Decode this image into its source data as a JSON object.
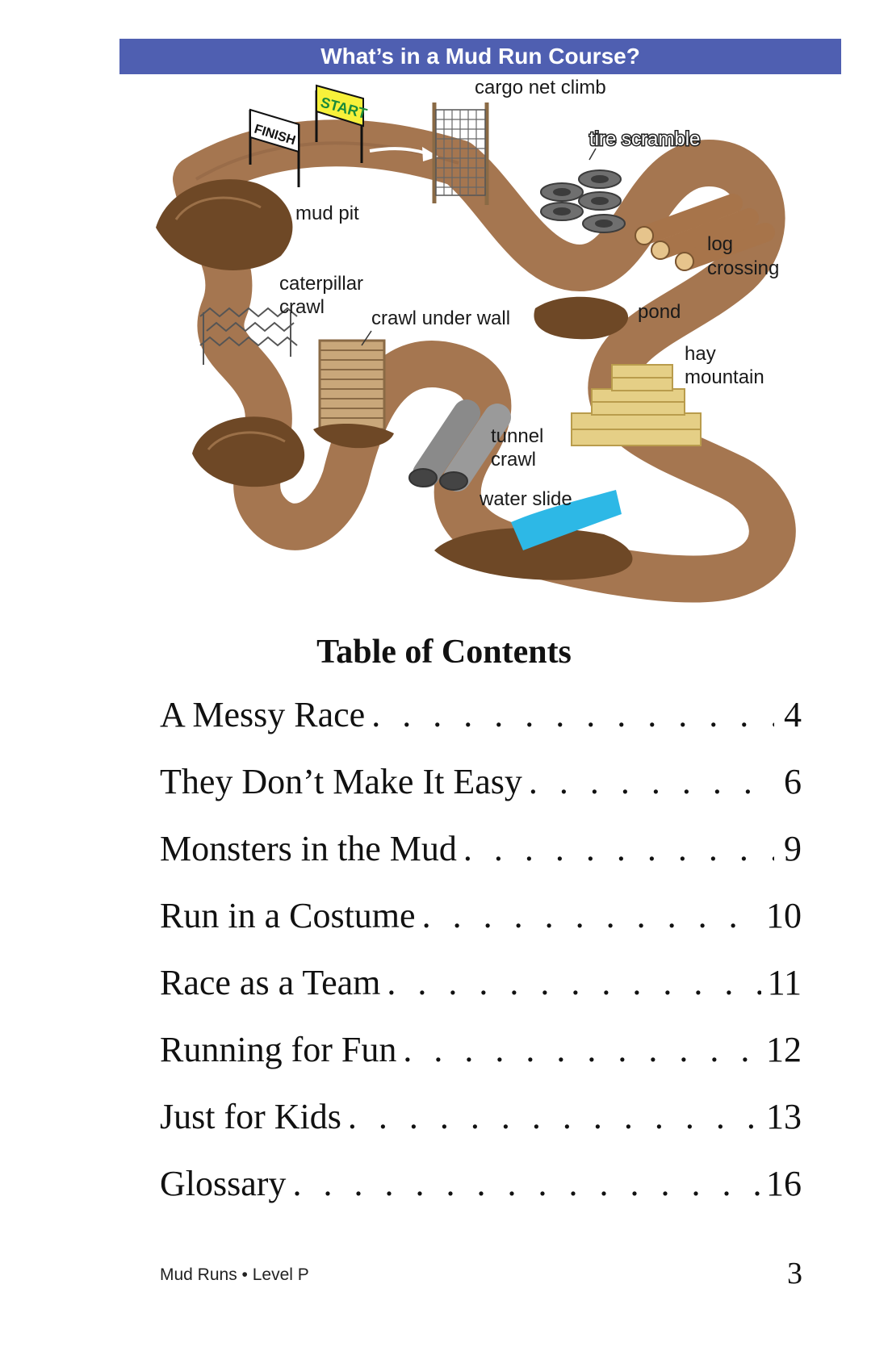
{
  "banner": {
    "title": "What’s in a Mud Run Course?"
  },
  "course": {
    "flags": {
      "finish": "FINISH",
      "start": "START"
    },
    "labels": {
      "cargo_net": "cargo net climb",
      "tire_scramble": "tire scramble",
      "mud_pit": "mud pit",
      "log_crossing_1": "log",
      "log_crossing_2": "crossing",
      "caterpillar_1": "caterpillar",
      "caterpillar_2": "crawl",
      "crawl_wall": "crawl under wall",
      "pond": "pond",
      "hay_1": "hay",
      "hay_2": "mountain",
      "tunnel_1": "tunnel",
      "tunnel_2": "crawl",
      "water_slide": "water slide"
    },
    "colors": {
      "track": "#a57650",
      "mud": "#6e4826",
      "water": "#2db8e6",
      "hay": "#e5cf86",
      "tire": "#6f6f6f"
    }
  },
  "toc": {
    "title": "Table of Contents",
    "entries": [
      {
        "title": "A Messy Race",
        "page": "4"
      },
      {
        "title": "They Don’t Make It Easy",
        "page": "6"
      },
      {
        "title": "Monsters in the Mud",
        "page": "9"
      },
      {
        "title": "Run in a Costume",
        "page": "10"
      },
      {
        "title": "Race as a Team",
        "page": "11"
      },
      {
        "title": "Running for Fun",
        "page": "12"
      },
      {
        "title": "Just for Kids",
        "page": "13"
      },
      {
        "title": "Glossary",
        "page": "16"
      }
    ]
  },
  "footer": {
    "book": "Mud Runs • Level P",
    "page_number": "3"
  }
}
